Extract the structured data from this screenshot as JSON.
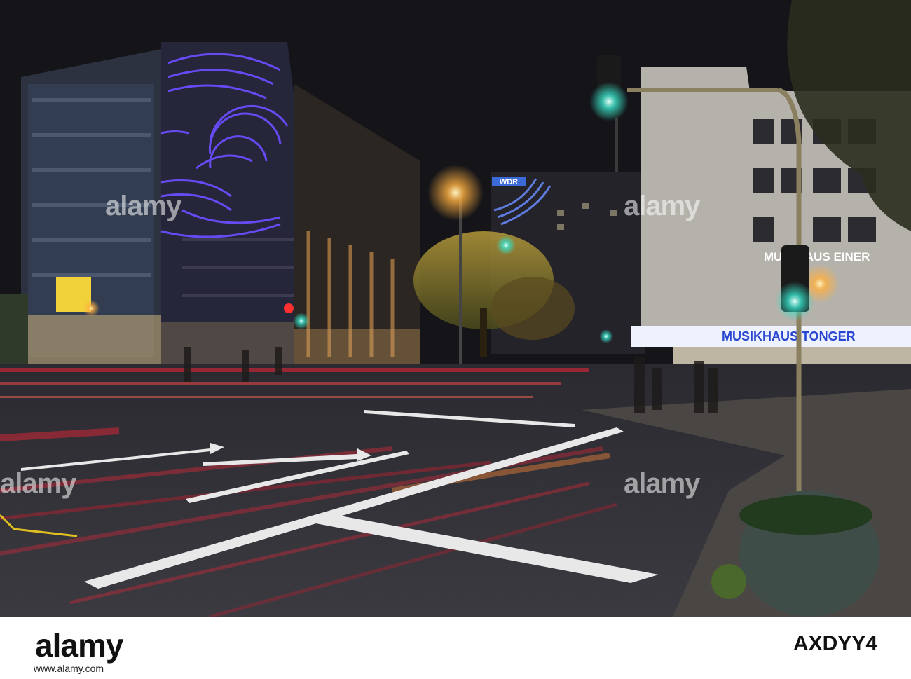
{
  "scene": {
    "signs": {
      "wdr": "WDR",
      "musik_aus_einer": "MUSIK AUS EINER",
      "musikhaus_tonger": "MUSIKHAUS TONGER"
    },
    "watermarks": [
      "alamy",
      "alamy",
      "alamy",
      "alamy"
    ],
    "colors": {
      "sky": "#141419",
      "neon_purple": "#6a4cff",
      "traffic_green": "#37e0c8",
      "street_light": "#ffb040",
      "light_trail_red": "#e0283a"
    }
  },
  "footer": {
    "logo": "alamy",
    "url": "www.alamy.com",
    "image_id": "AXDYY4"
  }
}
